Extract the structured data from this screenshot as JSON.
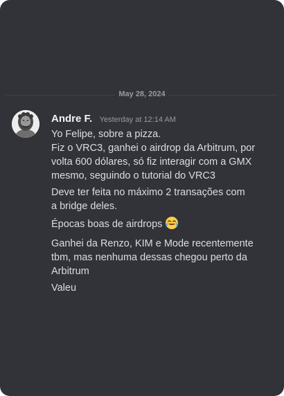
{
  "chat": {
    "date_divider": "May 28, 2024",
    "author": {
      "name": "Andre F.",
      "timestamp": "Yesterday at 12:14 AM",
      "avatar": "marble-bust-avatar"
    },
    "messages": [
      {
        "text": "Yo Felipe, sobre a pizza."
      },
      {
        "text": "Fiz o VRC3, ganhei o airdrop da Arbitrum, por\nvolta 600 dólares, só fiz interagir com a GMX\nmesmo, seguindo o tutorial do VRC3"
      },
      {
        "text": "Deve ter feita no máximo 2 transações com\na bridge deles."
      },
      {
        "text": "Épocas boas de airdrops",
        "emoji": "tears-of-joy-emoji"
      },
      {
        "text": "Ganhei da Renzo, KIM e Mode recentemente\ntbm, mas nenhuma dessas chegou perto da\nArbitrum"
      },
      {
        "text": "Valeu"
      }
    ]
  },
  "colors": {
    "background": "#313338",
    "text": "#dbdee1",
    "username": "#f2f3f5",
    "muted": "#949ba4",
    "divider": "#3f4147"
  }
}
